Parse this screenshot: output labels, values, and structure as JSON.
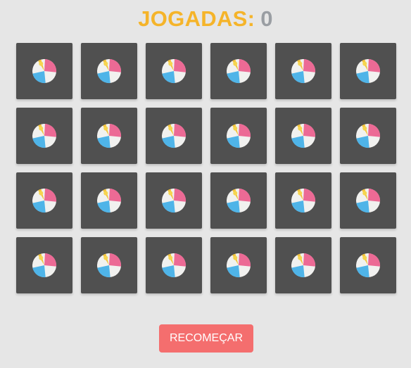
{
  "header": {
    "label": "JOGADAS:",
    "moves": "0"
  },
  "board": {
    "rows": 4,
    "columns": 6,
    "card_icon": "beach-ball-icon",
    "card_color": "#505050"
  },
  "controls": {
    "restart_label": "RECOMEÇAR"
  },
  "colors": {
    "background": "#e6e6e6",
    "label": "#f5b42a",
    "moves": "#9a9ea3",
    "restart": "#f46e6e"
  }
}
